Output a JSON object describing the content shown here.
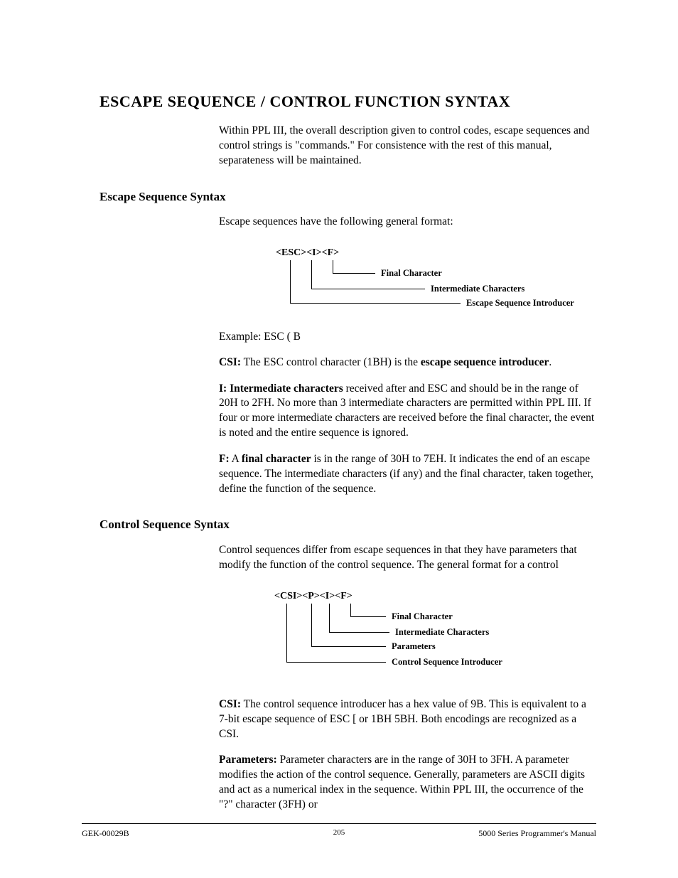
{
  "heading": "ESCAPE SEQUENCE / CONTROL FUNCTION SYNTAX",
  "intro": "Within PPL III, the overall description given to control codes, escape sequences and control strings is \"commands.\" For consistence with the rest of this manual, separateness will be maintained.",
  "section1": {
    "title": "Escape Sequence Syntax",
    "lead": "Escape sequences have the following general format:",
    "diagram": {
      "sequence": "<ESC><I><F>",
      "labels": {
        "final": "Final Character",
        "intermediate": "Intermediate Characters",
        "introducer": "Escape Sequence Introducer"
      }
    },
    "example": "Example: ESC ( B",
    "csi_label": "CSI:",
    "csi_text1": " The ESC control character (1BH) is the ",
    "csi_bold": "escape sequence introducer",
    "csi_text2": ".",
    "i_label": "I: Intermediate characters",
    "i_text": " received after and ESC and should be in the range of 20H to 2FH. No more than 3 intermediate characters are permitted within PPL III. If four or more intermediate characters are received before the final character, the event is noted and the entire sequence is ignored.",
    "f_label": "F:",
    "f_text1": " A ",
    "f_bold": "final character",
    "f_text2": " is in the range of 30H to 7EH. It indicates the end of an escape sequence. The intermediate characters (if any) and the final character, taken together, define the function of the sequence."
  },
  "section2": {
    "title": "Control Sequence Syntax",
    "lead": "Control sequences differ from escape sequences in that they have parameters that modify the function of the control sequence. The general format for a control",
    "diagram": {
      "sequence": "<CSI><P><I><F>",
      "labels": {
        "final": "Final Character",
        "intermediate": "Intermediate Characters",
        "parameters": "Parameters",
        "introducer": "Control Sequence Introducer"
      }
    },
    "csi_label": "CSI:",
    "csi_text": " The control sequence introducer has a hex value of 9B. This is equivalent to a 7-bit escape sequence of ESC [ or 1BH 5BH. Both encodings are recognized as a CSI.",
    "params_label": "Parameters:",
    "params_text": " Parameter characters are in the range of 30H to 3FH. A parameter modifies the action of the control sequence. Generally, parameters are ASCII digits and act as a numerical index in the sequence. Within PPL III, the occurrence of the \"?\" character (3FH) or"
  },
  "footer": {
    "left": "GEK-00029B",
    "center": "205",
    "right": "5000 Series Programmer's Manual"
  }
}
